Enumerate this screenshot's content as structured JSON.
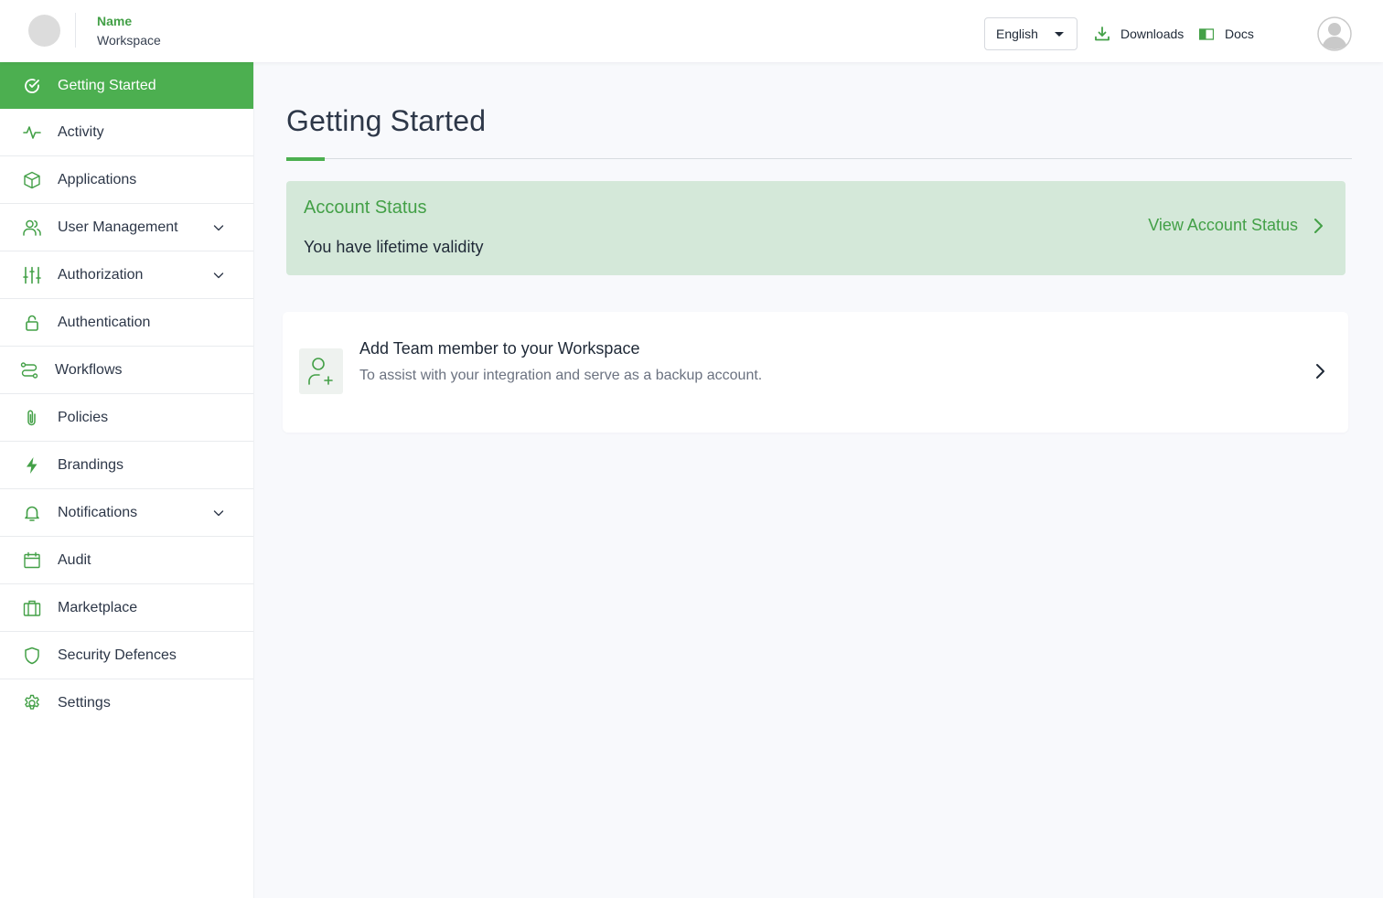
{
  "header": {
    "workspace_name": "Name",
    "workspace_sub": "Workspace",
    "language": "English",
    "downloads_label": "Downloads",
    "docs_label": "Docs"
  },
  "sidebar": {
    "items": [
      {
        "label": "Getting Started",
        "icon": "check-circle-icon",
        "active": true
      },
      {
        "label": "Activity",
        "icon": "activity-icon"
      },
      {
        "label": "Applications",
        "icon": "cube-icon"
      },
      {
        "label": "User Management",
        "icon": "users-icon",
        "expandable": true
      },
      {
        "label": "Authorization",
        "icon": "sliders-icon",
        "expandable": true
      },
      {
        "label": "Authentication",
        "icon": "lock-icon"
      },
      {
        "label": "Workflows",
        "icon": "workflow-icon"
      },
      {
        "label": "Policies",
        "icon": "paperclip-icon"
      },
      {
        "label": "Brandings",
        "icon": "bolt-icon"
      },
      {
        "label": "Notifications",
        "icon": "bell-icon",
        "expandable": true
      },
      {
        "label": "Audit",
        "icon": "calendar-icon"
      },
      {
        "label": "Marketplace",
        "icon": "briefcase-icon"
      },
      {
        "label": "Security Defences",
        "icon": "shield-icon"
      },
      {
        "label": "Settings",
        "icon": "gear-icon"
      }
    ]
  },
  "main": {
    "title": "Getting Started",
    "account_status": {
      "title": "Account Status",
      "text": "You have lifetime validity",
      "link_label": "View Account Status"
    },
    "task": {
      "title": "Add Team member to your Workspace",
      "description": "To assist with your integration and serve as a backup account."
    }
  },
  "colors": {
    "accent": "#4caf50",
    "accent_text": "#43a047",
    "status_bg": "#d4e8d9"
  }
}
